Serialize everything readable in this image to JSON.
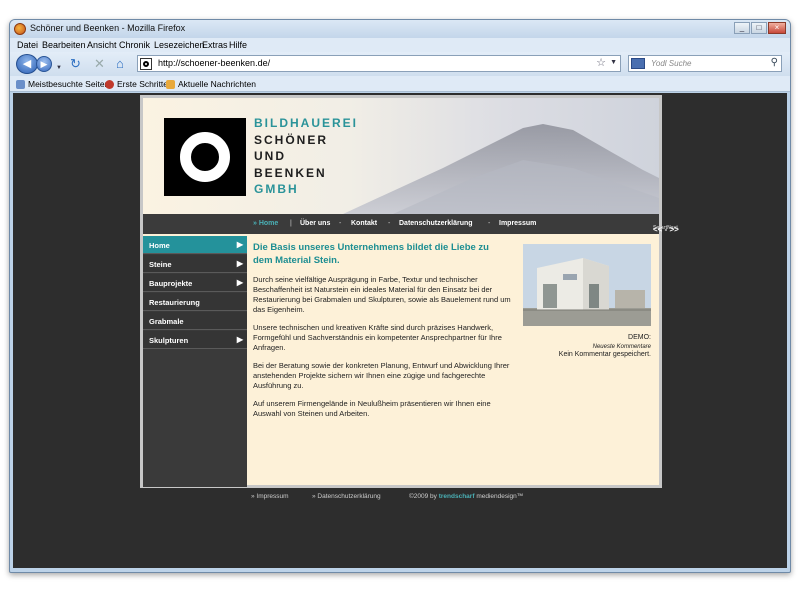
{
  "window": {
    "title": "Schöner und Beenken - Mozilla Firefox",
    "controls": [
      "_",
      "□",
      "×"
    ]
  },
  "menubar": {
    "items": [
      "Datei",
      "Bearbeiten",
      "Ansicht",
      "Chronik",
      "Lesezeichen",
      "Extras",
      "Hilfe"
    ]
  },
  "navbar": {
    "url": "http://schoener-beenken.de/",
    "search_placeholder": "Yodl Suche"
  },
  "bookmarks": {
    "items": [
      "Meistbesuchte Seiten",
      "Erste Schritte",
      "Aktuelle Nachrichten"
    ]
  },
  "site": {
    "firm_name": [
      "BILDHAUEREI",
      "SCHÖNER",
      "UND",
      "BEENKEN",
      "GMBH"
    ],
    "topnav": {
      "home": "» Home",
      "items": [
        "Über uns",
        "Kontakt",
        "Datenschutzerklärung",
        "Impressum"
      ],
      "sitenav_label": "SmartNavi",
      "sitenav_arrows": "<< - >>"
    },
    "leftnav": [
      "Home",
      "Steine",
      "Bauprojekte",
      "Restaurierung",
      "Grabmale",
      "Skulpturen"
    ],
    "heading": "Die Basis unseres Unternehmens bildet die Liebe zu dem Material Stein.",
    "paragraphs": [
      "Durch seine vielfältige Ausprägung in Farbe, Textur und technischer Beschaffenheit ist Naturstein ein ideales Material für den Einsatz bei der Restaurierung bei Grabmalen und Skulpturen, sowie als Bauelement rund um das Eigenheim.",
      "Unsere technischen und kreativen Kräfte sind durch präzises Handwerk, Formgefühl und Sachverständnis ein kompetenter Ansprechpartner für Ihre Anfragen.",
      "Bei der Beratung sowie der konkreten Planung, Entwurf und Abwicklung Ihrer anstehenden Projekte sichern wir Ihnen eine zügige und fachgerechte Ausführung zu.",
      "Auf unserem Firmengelände in Neulußheim präsentieren wir Ihnen eine Auswahl von Steinen und Arbeiten."
    ],
    "sidebar": {
      "demo": "DEMO:",
      "recent_comments": "Neueste Kommentare",
      "no_comment": "Kein Kommentar gespeichert."
    },
    "footer": {
      "impressum": "» Impressum",
      "datenschutz": "» Datenschutzerklärung",
      "copyright": "©2009 by",
      "brand": "trendscharf",
      "suffix": "mediendesign™"
    }
  },
  "colors": {
    "accent_teal": "#24929b",
    "firm_teal": "#2a9399",
    "firm_dark": "#1e1e1e"
  }
}
